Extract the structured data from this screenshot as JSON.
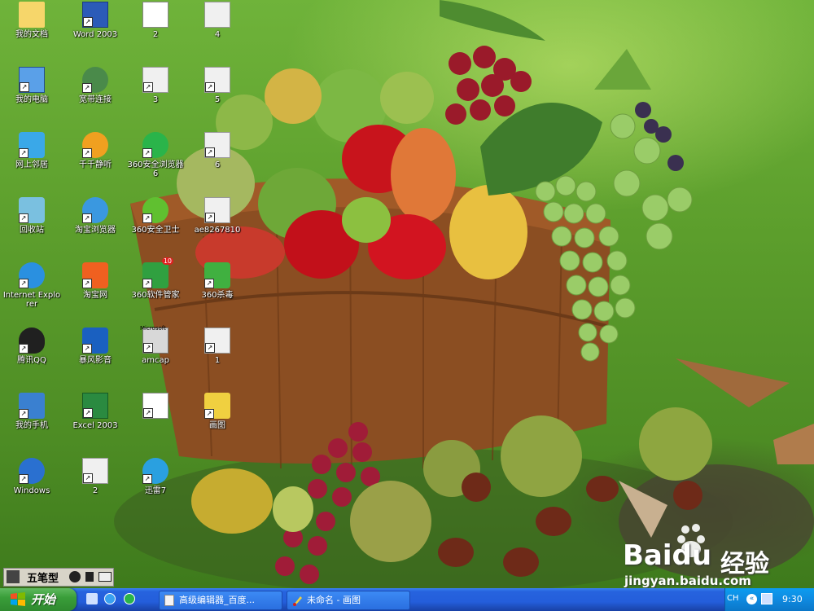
{
  "desktop": {
    "icons": [
      {
        "label": "我的文档",
        "icon": "my-documents-icon"
      },
      {
        "label": "Word 2003",
        "icon": "word-icon"
      },
      {
        "label": "2",
        "icon": "image-file-icon"
      },
      {
        "label": "4",
        "icon": "archive-file-icon"
      },
      {
        "label": "我的电脑",
        "icon": "my-computer-icon"
      },
      {
        "label": "宽带连接",
        "icon": "broadband-icon"
      },
      {
        "label": "3",
        "icon": "archive-file-icon"
      },
      {
        "label": "5",
        "icon": "archive-file-icon"
      },
      {
        "label": "网上邻居",
        "icon": "network-icon"
      },
      {
        "label": "千千静听",
        "icon": "ttplayer-icon"
      },
      {
        "label": "360安全浏览器6",
        "icon": "360-browser-icon"
      },
      {
        "label": "6",
        "icon": "archive-file-icon"
      },
      {
        "label": "回收站",
        "icon": "recycle-bin-icon"
      },
      {
        "label": "淘宝浏览器",
        "icon": "taobao-browser-icon"
      },
      {
        "label": "360安全卫士",
        "icon": "360-safe-icon"
      },
      {
        "label": "ae8267810",
        "icon": "archive-file-icon"
      },
      {
        "label": "Internet Explorer",
        "icon": "ie-icon"
      },
      {
        "label": "淘宝网",
        "icon": "taobao-icon"
      },
      {
        "label": "360软件管家",
        "icon": "360-software-icon",
        "badge": "10"
      },
      {
        "label": "360杀毒",
        "icon": "360-antivirus-icon"
      },
      {
        "label": "腾讯QQ",
        "icon": "qq-icon"
      },
      {
        "label": "暴风影音",
        "icon": "storm-player-icon"
      },
      {
        "label": "amcap",
        "icon": "amcap-icon",
        "sublabel": "Microsoft"
      },
      {
        "label": "1",
        "icon": "archive-file-icon"
      },
      {
        "label": "我的手机",
        "icon": "phone-icon"
      },
      {
        "label": "Excel 2003",
        "icon": "excel-icon"
      },
      {
        "label": "",
        "icon": "image-file-icon"
      },
      {
        "label": "画图",
        "icon": "paint-icon"
      },
      {
        "label": "Windows",
        "icon": "media-player-icon"
      },
      {
        "label": "2",
        "icon": "archive-file-icon"
      },
      {
        "label": "迅雷7",
        "icon": "xunlei-icon"
      }
    ]
  },
  "ime_bar": {
    "label": "五笔型"
  },
  "taskbar": {
    "start_label": "开始",
    "windows": [
      {
        "label": "高级编辑器_百度...",
        "icon": "document-icon"
      },
      {
        "label": "未命名 - 画图",
        "icon": "paint-icon"
      }
    ],
    "tray": {
      "lang": "CH",
      "clock": "9:30"
    }
  },
  "watermark": {
    "brand": "Baidu",
    "brand_cn": "经验",
    "url": "jingyan.baidu.com"
  },
  "colors": {
    "taskbar": "#245edb",
    "start": "#3a9e3a",
    "tray": "#0f8ae0"
  }
}
